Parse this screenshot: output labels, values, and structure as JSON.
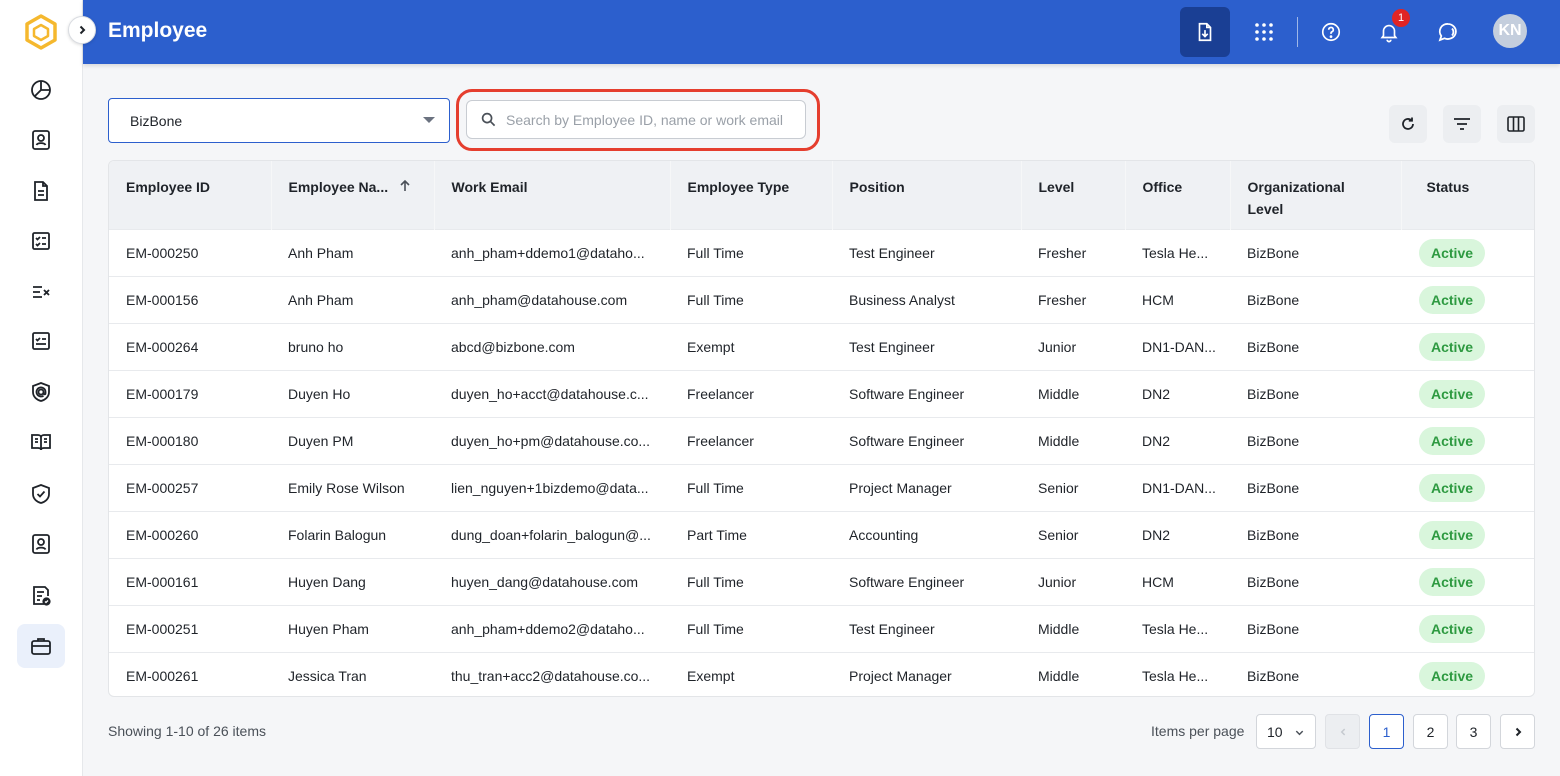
{
  "header": {
    "title": "Employee",
    "notification_count": "1",
    "avatar_initials": "KN"
  },
  "toolbar": {
    "company_value": "BizBone",
    "search_placeholder": "Search by Employee ID, name or work email"
  },
  "table": {
    "columns": [
      "Employee ID",
      "Employee Na...",
      "Work Email",
      "Employee Type",
      "Position",
      "Level",
      "Office",
      "Organizational Level",
      "Status"
    ],
    "rows": [
      {
        "id": "EM-000250",
        "name": "Anh Pham",
        "email": "anh_pham+ddemo1@dataho...",
        "type": "Full Time",
        "position": "Test Engineer",
        "level": "Fresher",
        "office": "Tesla He...",
        "org": "BizBone",
        "status": "Active"
      },
      {
        "id": "EM-000156",
        "name": "Anh Pham",
        "email": "anh_pham@datahouse.com",
        "type": "Full Time",
        "position": "Business Analyst",
        "level": "Fresher",
        "office": "HCM",
        "org": "BizBone",
        "status": "Active"
      },
      {
        "id": "EM-000264",
        "name": "bruno ho",
        "email": "abcd@bizbone.com",
        "type": "Exempt",
        "position": "Test Engineer",
        "level": "Junior",
        "office": "DN1-DAN...",
        "org": "BizBone",
        "status": "Active"
      },
      {
        "id": "EM-000179",
        "name": "Duyen Ho",
        "email": "duyen_ho+acct@datahouse.c...",
        "type": "Freelancer",
        "position": "Software Engineer",
        "level": "Middle",
        "office": "DN2",
        "org": "BizBone",
        "status": "Active"
      },
      {
        "id": "EM-000180",
        "name": "Duyen PM",
        "email": "duyen_ho+pm@datahouse.co...",
        "type": "Freelancer",
        "position": "Software Engineer",
        "level": "Middle",
        "office": "DN2",
        "org": "BizBone",
        "status": "Active"
      },
      {
        "id": "EM-000257",
        "name": "Emily Rose Wilson",
        "email": "lien_nguyen+1bizdemo@data...",
        "type": "Full Time",
        "position": "Project Manager",
        "level": "Senior",
        "office": "DN1-DAN...",
        "org": "BizBone",
        "status": "Active"
      },
      {
        "id": "EM-000260",
        "name": "Folarin Balogun",
        "email": "dung_doan+folarin_balogun@...",
        "type": "Part Time",
        "position": "Accounting",
        "level": "Senior",
        "office": "DN2",
        "org": "BizBone",
        "status": "Active"
      },
      {
        "id": "EM-000161",
        "name": "Huyen Dang",
        "email": "huyen_dang@datahouse.com",
        "type": "Full Time",
        "position": "Software Engineer",
        "level": "Junior",
        "office": "HCM",
        "org": "BizBone",
        "status": "Active"
      },
      {
        "id": "EM-000251",
        "name": "Huyen Pham",
        "email": "anh_pham+ddemo2@dataho...",
        "type": "Full Time",
        "position": "Test Engineer",
        "level": "Middle",
        "office": "Tesla He...",
        "org": "BizBone",
        "status": "Active"
      },
      {
        "id": "EM-000261",
        "name": "Jessica Tran",
        "email": "thu_tran+acc2@datahouse.co...",
        "type": "Exempt",
        "position": "Project Manager",
        "level": "Middle",
        "office": "Tesla He...",
        "org": "BizBone",
        "status": "Active"
      }
    ]
  },
  "footer": {
    "showing": "Showing 1-10 of 26 items",
    "items_per_page_label": "Items per page",
    "items_per_page_value": "10",
    "pages": [
      "1",
      "2",
      "3"
    ],
    "current_page": "1"
  },
  "icons": {
    "sidebar": [
      "pie-chart-icon",
      "contact-card-icon",
      "document-icon",
      "checklist-icon",
      "task-check-icon",
      "approval-icon",
      "at-shield-icon",
      "book-icon",
      "shield-check-icon",
      "id-badge-icon",
      "document-check-icon",
      "briefcase-icon"
    ],
    "header": [
      "export-icon",
      "apps-grid-icon",
      "help-icon",
      "bell-icon",
      "chat-icon"
    ],
    "toolbar": [
      "refresh-icon",
      "filter-icon",
      "columns-icon"
    ]
  },
  "colors": {
    "accent": "#2c5fcd",
    "status_active_bg": "#d9f6dc",
    "status_active_text": "#2e9a41",
    "highlight": "#e53e2e"
  }
}
